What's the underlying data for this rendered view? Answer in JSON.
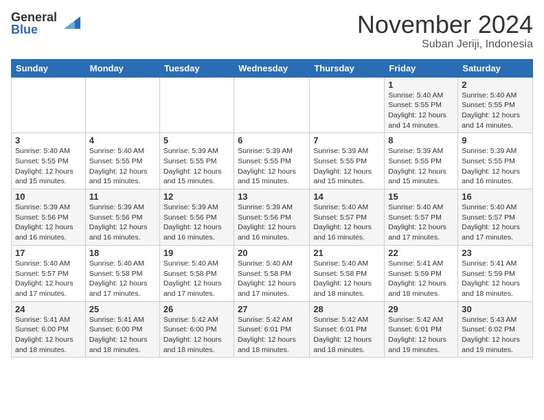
{
  "logo": {
    "general": "General",
    "blue": "Blue"
  },
  "header": {
    "month": "November 2024",
    "location": "Suban Jeriji, Indonesia"
  },
  "weekdays": [
    "Sunday",
    "Monday",
    "Tuesday",
    "Wednesday",
    "Thursday",
    "Friday",
    "Saturday"
  ],
  "weeks": [
    [
      {
        "day": "",
        "info": ""
      },
      {
        "day": "",
        "info": ""
      },
      {
        "day": "",
        "info": ""
      },
      {
        "day": "",
        "info": ""
      },
      {
        "day": "",
        "info": ""
      },
      {
        "day": "1",
        "info": "Sunrise: 5:40 AM\nSunset: 5:55 PM\nDaylight: 12 hours\nand 14 minutes."
      },
      {
        "day": "2",
        "info": "Sunrise: 5:40 AM\nSunset: 5:55 PM\nDaylight: 12 hours\nand 14 minutes."
      }
    ],
    [
      {
        "day": "3",
        "info": "Sunrise: 5:40 AM\nSunset: 5:55 PM\nDaylight: 12 hours\nand 15 minutes."
      },
      {
        "day": "4",
        "info": "Sunrise: 5:40 AM\nSunset: 5:55 PM\nDaylight: 12 hours\nand 15 minutes."
      },
      {
        "day": "5",
        "info": "Sunrise: 5:39 AM\nSunset: 5:55 PM\nDaylight: 12 hours\nand 15 minutes."
      },
      {
        "day": "6",
        "info": "Sunrise: 5:39 AM\nSunset: 5:55 PM\nDaylight: 12 hours\nand 15 minutes."
      },
      {
        "day": "7",
        "info": "Sunrise: 5:39 AM\nSunset: 5:55 PM\nDaylight: 12 hours\nand 15 minutes."
      },
      {
        "day": "8",
        "info": "Sunrise: 5:39 AM\nSunset: 5:55 PM\nDaylight: 12 hours\nand 15 minutes."
      },
      {
        "day": "9",
        "info": "Sunrise: 5:39 AM\nSunset: 5:55 PM\nDaylight: 12 hours\nand 16 minutes."
      }
    ],
    [
      {
        "day": "10",
        "info": "Sunrise: 5:39 AM\nSunset: 5:56 PM\nDaylight: 12 hours\nand 16 minutes."
      },
      {
        "day": "11",
        "info": "Sunrise: 5:39 AM\nSunset: 5:56 PM\nDaylight: 12 hours\nand 16 minutes."
      },
      {
        "day": "12",
        "info": "Sunrise: 5:39 AM\nSunset: 5:56 PM\nDaylight: 12 hours\nand 16 minutes."
      },
      {
        "day": "13",
        "info": "Sunrise: 5:39 AM\nSunset: 5:56 PM\nDaylight: 12 hours\nand 16 minutes."
      },
      {
        "day": "14",
        "info": "Sunrise: 5:40 AM\nSunset: 5:57 PM\nDaylight: 12 hours\nand 16 minutes."
      },
      {
        "day": "15",
        "info": "Sunrise: 5:40 AM\nSunset: 5:57 PM\nDaylight: 12 hours\nand 17 minutes."
      },
      {
        "day": "16",
        "info": "Sunrise: 5:40 AM\nSunset: 5:57 PM\nDaylight: 12 hours\nand 17 minutes."
      }
    ],
    [
      {
        "day": "17",
        "info": "Sunrise: 5:40 AM\nSunset: 5:57 PM\nDaylight: 12 hours\nand 17 minutes."
      },
      {
        "day": "18",
        "info": "Sunrise: 5:40 AM\nSunset: 5:58 PM\nDaylight: 12 hours\nand 17 minutes."
      },
      {
        "day": "19",
        "info": "Sunrise: 5:40 AM\nSunset: 5:58 PM\nDaylight: 12 hours\nand 17 minutes."
      },
      {
        "day": "20",
        "info": "Sunrise: 5:40 AM\nSunset: 5:58 PM\nDaylight: 12 hours\nand 17 minutes."
      },
      {
        "day": "21",
        "info": "Sunrise: 5:40 AM\nSunset: 5:58 PM\nDaylight: 12 hours\nand 18 minutes."
      },
      {
        "day": "22",
        "info": "Sunrise: 5:41 AM\nSunset: 5:59 PM\nDaylight: 12 hours\nand 18 minutes."
      },
      {
        "day": "23",
        "info": "Sunrise: 5:41 AM\nSunset: 5:59 PM\nDaylight: 12 hours\nand 18 minutes."
      }
    ],
    [
      {
        "day": "24",
        "info": "Sunrise: 5:41 AM\nSunset: 6:00 PM\nDaylight: 12 hours\nand 18 minutes."
      },
      {
        "day": "25",
        "info": "Sunrise: 5:41 AM\nSunset: 6:00 PM\nDaylight: 12 hours\nand 18 minutes."
      },
      {
        "day": "26",
        "info": "Sunrise: 5:42 AM\nSunset: 6:00 PM\nDaylight: 12 hours\nand 18 minutes."
      },
      {
        "day": "27",
        "info": "Sunrise: 5:42 AM\nSunset: 6:01 PM\nDaylight: 12 hours\nand 18 minutes."
      },
      {
        "day": "28",
        "info": "Sunrise: 5:42 AM\nSunset: 6:01 PM\nDaylight: 12 hours\nand 18 minutes."
      },
      {
        "day": "29",
        "info": "Sunrise: 5:42 AM\nSunset: 6:01 PM\nDaylight: 12 hours\nand 19 minutes."
      },
      {
        "day": "30",
        "info": "Sunrise: 5:43 AM\nSunset: 6:02 PM\nDaylight: 12 hours\nand 19 minutes."
      }
    ]
  ]
}
